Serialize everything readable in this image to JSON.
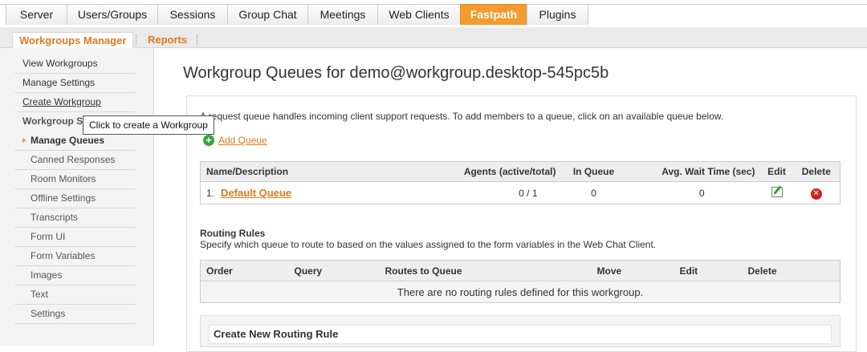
{
  "top_tabs": [
    "Server",
    "Users/Groups",
    "Sessions",
    "Group Chat",
    "Meetings",
    "Web Clients",
    "Fastpath",
    "Plugins"
  ],
  "active_top_tab": "Fastpath",
  "sub_tabs": [
    "Workgroups Manager",
    "Reports"
  ],
  "sidebar": {
    "items": [
      "View Workgroups",
      "Manage Settings",
      "Create Workgroup"
    ],
    "section_label": "Workgroup S",
    "sub_items": [
      "Manage Queues",
      "Canned Responses",
      "Room Monitors",
      "Offline Settings",
      "Transcripts",
      "Form UI",
      "Form Variables",
      "Images",
      "Text",
      "Settings"
    ]
  },
  "tooltip": "Click to create a Workgroup",
  "page_title": "Workgroup Queues for demo@workgroup.desktop-545pc5b",
  "intro_text": "A request queue handles incoming client support requests. To add members to a queue, click on an available queue below.",
  "add_queue_label": "Add Queue",
  "queue_table": {
    "headers": [
      "Name/Description",
      "Agents (active/total)",
      "In Queue",
      "Avg. Wait Time (sec)",
      "Edit",
      "Delete"
    ],
    "rows": [
      {
        "num": "1.",
        "name": "Default Queue",
        "agents": "0 / 1",
        "in_queue": "0",
        "avg_wait": "0"
      }
    ]
  },
  "routing": {
    "title": "Routing Rules",
    "description": "Specify which queue to route to based on the values assigned to the form variables in the Web Chat Client.",
    "headers": [
      "Order",
      "Query",
      "Routes to Queue",
      "Move",
      "Edit",
      "Delete"
    ],
    "empty_text": "There are no routing rules defined for this workgroup."
  },
  "create_rule_title": "Create New Routing Rule",
  "colors": {
    "accent": "#f39b2f",
    "link": "#e0791e"
  }
}
